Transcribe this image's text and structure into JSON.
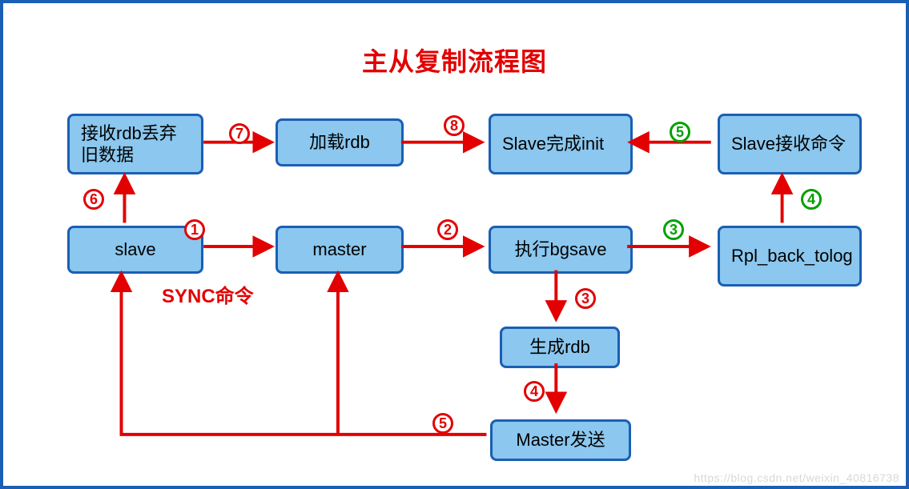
{
  "title": "主从复制流程图",
  "nodes": {
    "slave": {
      "text": "slave"
    },
    "master": {
      "text": "master"
    },
    "exec_bgsave": {
      "text": "执行bgsave"
    },
    "rpl_back": {
      "text": "Rpl_back_tolog"
    },
    "recv_rdb": {
      "text": "接收rdb丢弃旧数据"
    },
    "load_rdb": {
      "text": "加载rdb"
    },
    "slave_init": {
      "text": "Slave完成init"
    },
    "slave_recv": {
      "text": "Slave接收命令"
    },
    "gen_rdb": {
      "text": "生成rdb"
    },
    "master_send": {
      "text": "Master发送"
    }
  },
  "labels": {
    "sync": "SYNC命令"
  },
  "badges": {
    "b1": {
      "n": "1",
      "color": "red"
    },
    "b2": {
      "n": "2",
      "color": "red"
    },
    "b3g": {
      "n": "3",
      "color": "green"
    },
    "b3r": {
      "n": "3",
      "color": "red"
    },
    "b4g": {
      "n": "4",
      "color": "green"
    },
    "b4r": {
      "n": "4",
      "color": "red"
    },
    "b5g": {
      "n": "5",
      "color": "green"
    },
    "b5r": {
      "n": "5",
      "color": "red"
    },
    "b6": {
      "n": "6",
      "color": "red"
    },
    "b7": {
      "n": "7",
      "color": "red"
    },
    "b8": {
      "n": "8",
      "color": "red"
    }
  },
  "watermark": "https://blog.csdn.net/weixin_40816738",
  "chart_data": {
    "type": "diagram",
    "title": "主从复制流程图",
    "nodes": [
      {
        "id": "slave",
        "label": "slave"
      },
      {
        "id": "master",
        "label": "master"
      },
      {
        "id": "exec_bgsave",
        "label": "执行bgsave"
      },
      {
        "id": "rpl_back",
        "label": "Rpl_back_tolog"
      },
      {
        "id": "recv_rdb",
        "label": "接收rdb丢弃旧数据"
      },
      {
        "id": "load_rdb",
        "label": "加载rdb"
      },
      {
        "id": "slave_init",
        "label": "Slave完成init"
      },
      {
        "id": "slave_recv",
        "label": "Slave接收命令"
      },
      {
        "id": "gen_rdb",
        "label": "生成rdb"
      },
      {
        "id": "master_send",
        "label": "Master发送"
      }
    ],
    "edges": [
      {
        "from": "slave",
        "to": "master",
        "step": "1",
        "label": "SYNC命令",
        "color": "red"
      },
      {
        "from": "master",
        "to": "exec_bgsave",
        "step": "2",
        "color": "red"
      },
      {
        "from": "exec_bgsave",
        "to": "rpl_back",
        "step": "3",
        "color": "green"
      },
      {
        "from": "rpl_back",
        "to": "slave_recv",
        "step": "4",
        "color": "green"
      },
      {
        "from": "slave_recv",
        "to": "slave_init",
        "step": "5",
        "color": "green"
      },
      {
        "from": "exec_bgsave",
        "to": "gen_rdb",
        "step": "3",
        "color": "red"
      },
      {
        "from": "gen_rdb",
        "to": "master_send",
        "step": "4",
        "color": "red"
      },
      {
        "from": "master_send",
        "to": "slave",
        "step": "5",
        "color": "red"
      },
      {
        "from": "master_send",
        "to": "master",
        "step": "5",
        "color": "red"
      },
      {
        "from": "slave",
        "to": "recv_rdb",
        "step": "6",
        "color": "red"
      },
      {
        "from": "recv_rdb",
        "to": "load_rdb",
        "step": "7",
        "color": "red"
      },
      {
        "from": "load_rdb",
        "to": "slave_init",
        "step": "8",
        "color": "red"
      }
    ]
  }
}
